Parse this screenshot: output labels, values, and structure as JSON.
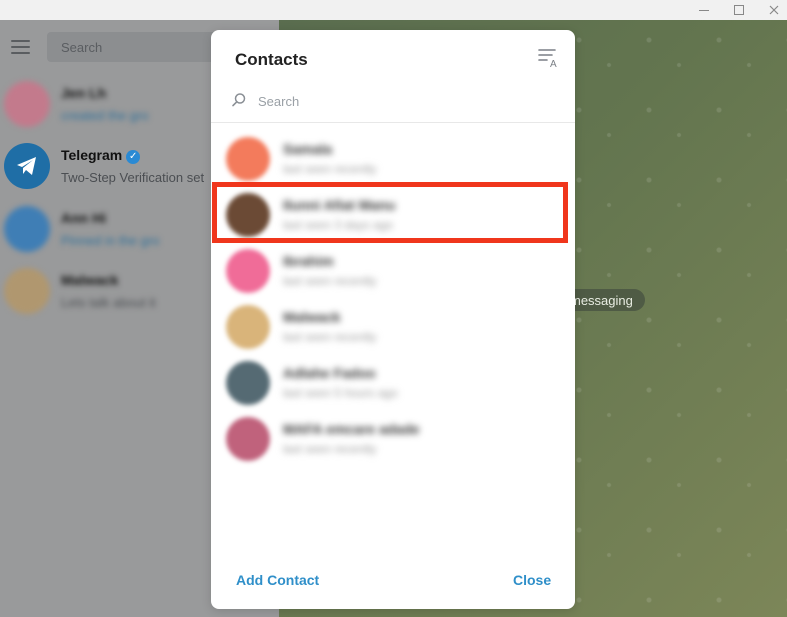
{
  "sidebar": {
    "search_placeholder": "Search",
    "chats": [
      {
        "name": "Jen Lh",
        "message": "created the gro",
        "avatar_color": "#c37a8c",
        "blurred": true
      },
      {
        "name": "Telegram",
        "message": "Two-Step Verification set",
        "avatar_color": "#1f6ea6",
        "blurred": false,
        "verified": true
      },
      {
        "name": "Ann Hi",
        "message": "Pinned in the gro",
        "avatar_color": "#3f7eb5",
        "blurred": true
      },
      {
        "name": "Malwack",
        "message": "Lets talk about it",
        "avatar_color": "#b0976f",
        "blurred": true
      }
    ]
  },
  "chat_area": {
    "pill_text": "messaging"
  },
  "modal": {
    "title": "Contacts",
    "search_placeholder": "Search",
    "contacts": [
      {
        "name": "Samala",
        "status": "last seen recently",
        "avatar_color": "#f37b5c"
      },
      {
        "name": "Ilunni Afiat Manu",
        "status": "last seen 3 days ago",
        "avatar_color": "#6b4a35"
      },
      {
        "name": "Ibrahim",
        "status": "last seen recently",
        "avatar_color": "#f06c98"
      },
      {
        "name": "Malwack",
        "status": "last seen recently",
        "avatar_color": "#d9b47a"
      },
      {
        "name": "Adlahe Fadoo",
        "status": "last seen 5 hours ago",
        "avatar_color": "#556a73"
      },
      {
        "name": "MAFA emcare adade",
        "status": "last seen recently",
        "avatar_color": "#c0627c"
      }
    ],
    "add_contact_label": "Add Contact",
    "close_label": "Close"
  },
  "colors": {
    "accent": "#2f8fc9",
    "highlight": "#f0361c"
  }
}
